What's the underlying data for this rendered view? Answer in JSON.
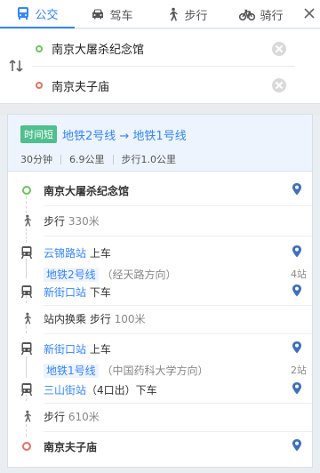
{
  "tabs": [
    {
      "label": "公交",
      "icon": "bus-icon",
      "active": true
    },
    {
      "label": "驾车",
      "icon": "car-icon",
      "active": false
    },
    {
      "label": "步行",
      "icon": "walk-icon",
      "active": false
    },
    {
      "label": "骑行",
      "icon": "bike-icon",
      "active": false
    }
  ],
  "close_icon": "close-icon",
  "inputs": {
    "origin": "南京大屠杀纪念馆",
    "destination": "南京夫子庙"
  },
  "summary": {
    "badge": "时间短",
    "route": "地铁2号线 → 地铁1号线",
    "duration": "30分钟",
    "distance": "6.9公里",
    "walk": "步行1.0公里"
  },
  "steps": {
    "start": "南京大屠杀纪念馆",
    "walk1": "步行",
    "walk1_dist": "330米",
    "board1_station": "云锦路站",
    "board1_action": "上车",
    "line1": "地铁2号线",
    "line1_dir": "（经天路方向）",
    "line1_stops": "4站",
    "alight1_station": "新街口站",
    "alight1_action": "下车",
    "transfer": "站内换乘 步行",
    "transfer_dist": "100米",
    "board2_station": "新街口站",
    "board2_action": "上车",
    "line2": "地铁1号线",
    "line2_dir": "（中国药科大学方向）",
    "line2_stops": "2站",
    "alight2_station": "三山街站",
    "alight2_exit": "（4口出）",
    "alight2_action": "下车",
    "walk2": "步行",
    "walk2_dist": "610米",
    "end": "南京夫子庙"
  },
  "colors": {
    "accent": "#3385ff",
    "start_dot": "#6bc45b",
    "end_dot": "#e5715e",
    "badge": "#4fbf8d"
  }
}
